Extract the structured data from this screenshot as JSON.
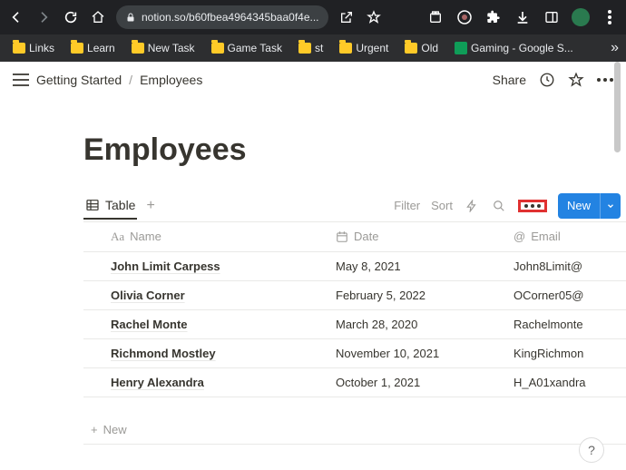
{
  "browser": {
    "url_display": "notion.so/b60fbea4964345baa0f4e...",
    "bookmarks": [
      "Links",
      "Learn",
      "New Task",
      "Game Task",
      "st",
      "Urgent",
      "Old"
    ],
    "bookmark_sheets": "Gaming - Google S..."
  },
  "breadcrumb": {
    "root": "Getting Started",
    "current": "Employees"
  },
  "topbar": {
    "share": "Share"
  },
  "page": {
    "title": "Employees"
  },
  "db": {
    "view_tab": "Table",
    "filter": "Filter",
    "sort": "Sort",
    "new_btn": "New",
    "new_row": "New",
    "columns": {
      "name": "Name",
      "date": "Date",
      "email": "Email"
    },
    "rows": [
      {
        "name": "John Limit Carpess",
        "date": "May 8, 2021",
        "email": "John8Limit@"
      },
      {
        "name": "Olivia Corner",
        "date": "February 5, 2022",
        "email": "OCorner05@"
      },
      {
        "name": "Rachel Monte",
        "date": "March 28, 2020",
        "email": "Rachelmonte"
      },
      {
        "name": "Richmond Mostley",
        "date": "November 10, 2021",
        "email": "KingRichmon"
      },
      {
        "name": "Henry Alexandra",
        "date": "October 1, 2021",
        "email": "H_A01xandra"
      }
    ]
  },
  "help": "?"
}
